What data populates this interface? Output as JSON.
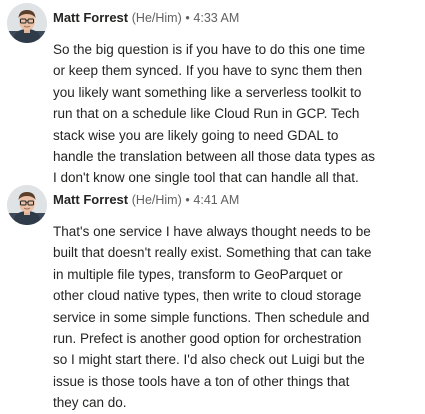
{
  "messages": [
    {
      "author": "Matt Forrest",
      "pronouns": "(He/Him)",
      "separator": "•",
      "time": "4:33 AM",
      "lines": [
        "So the big question is if you have to do this one time",
        "or keep them synced. If you have to sync them then",
        "you likely want something like a serverless toolkit to",
        "run that on a schedule like Cloud Run in GCP. Tech",
        "stack wise you are likely going to need GDAL to",
        "handle the translation between all those data types as",
        "I don't know one single tool that can handle all that."
      ]
    },
    {
      "author": "Matt Forrest",
      "pronouns": "(He/Him)",
      "separator": "•",
      "time": "4:41 AM",
      "lines": [
        "That's one service I have always thought needs to be",
        "built that doesn't really exist. Something that can take",
        "in multiple file types, transform to GeoParquet or",
        "other cloud native types, then write to cloud storage",
        "service in some simple functions. Then schedule and",
        "run. Prefect is another good option for orchestration",
        "so I might start there. I'd also check out Luigi but the",
        "issue is those tools have a ton of other things that",
        "they can do."
      ]
    }
  ]
}
